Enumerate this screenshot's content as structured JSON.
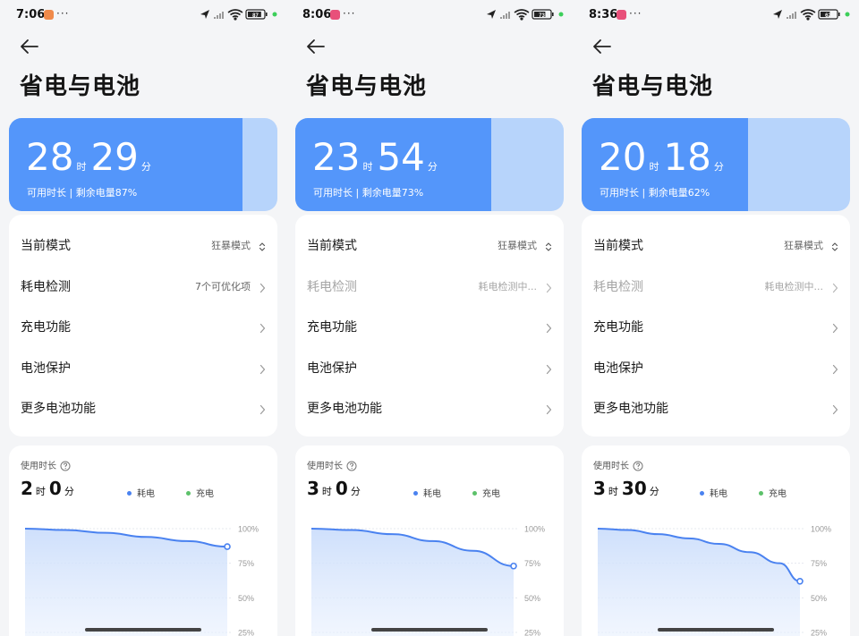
{
  "panels": [
    {
      "status": {
        "time": "7:06",
        "app_color": "#f08a4b",
        "more": "···",
        "battery_text": "87"
      },
      "title": "省电与电池",
      "battery": {
        "hours": "28",
        "hour_unit": "时",
        "minutes": "29",
        "minute_unit": "分",
        "subtitle": "可用时长 | 剩余电量87%",
        "level": 0.87
      },
      "menu": [
        {
          "label": "当前模式",
          "value": "狂暴模式",
          "icon": "updown-icon",
          "dim": false
        },
        {
          "label": "耗电检测",
          "value": "7个可优化项",
          "icon": "chevron-right-icon",
          "dim": false
        },
        {
          "label": "充电功能",
          "value": "",
          "icon": "chevron-right-icon",
          "dim": false
        },
        {
          "label": "电池保护",
          "value": "",
          "icon": "chevron-right-icon",
          "dim": false
        },
        {
          "label": "更多电池功能",
          "value": "",
          "icon": "chevron-right-icon",
          "dim": false
        }
      ],
      "usage": {
        "label": "使用时长",
        "hours": "2",
        "hour_unit": "时",
        "minutes": "0",
        "minute_unit": "分",
        "legend": [
          {
            "label": "耗电",
            "color": "#4a82f0"
          },
          {
            "label": "充电",
            "color": "#5cc16a"
          }
        ]
      },
      "chart_data": {
        "type": "area",
        "x": [
          0,
          0.2,
          0.4,
          0.6,
          0.8,
          1.0
        ],
        "series": [
          {
            "values": [
              100,
              99,
              97,
              94,
              91,
              87
            ]
          }
        ],
        "y_ticks": [
          "100%",
          "75%",
          "50%",
          "25%"
        ],
        "ylim": [
          25,
          100
        ]
      }
    },
    {
      "status": {
        "time": "8:06",
        "app_color": "#e8507a",
        "more": "···",
        "battery_text": "73"
      },
      "title": "省电与电池",
      "battery": {
        "hours": "23",
        "hour_unit": "时",
        "minutes": "54",
        "minute_unit": "分",
        "subtitle": "可用时长 | 剩余电量73%",
        "level": 0.73
      },
      "menu": [
        {
          "label": "当前模式",
          "value": "狂暴模式",
          "icon": "updown-icon",
          "dim": false
        },
        {
          "label": "耗电检测",
          "value": "耗电检测中...",
          "icon": "chevron-right-icon",
          "dim": true
        },
        {
          "label": "充电功能",
          "value": "",
          "icon": "chevron-right-icon",
          "dim": false
        },
        {
          "label": "电池保护",
          "value": "",
          "icon": "chevron-right-icon",
          "dim": false
        },
        {
          "label": "更多电池功能",
          "value": "",
          "icon": "chevron-right-icon",
          "dim": false
        }
      ],
      "usage": {
        "label": "使用时长",
        "hours": "3",
        "hour_unit": "时",
        "minutes": "0",
        "minute_unit": "分",
        "legend": [
          {
            "label": "耗电",
            "color": "#4a82f0"
          },
          {
            "label": "充电",
            "color": "#5cc16a"
          }
        ]
      },
      "chart_data": {
        "type": "area",
        "x": [
          0,
          0.2,
          0.4,
          0.6,
          0.8,
          1.0
        ],
        "series": [
          {
            "values": [
              100,
              99,
              96,
              91,
              84,
              73
            ]
          }
        ],
        "y_ticks": [
          "100%",
          "75%",
          "50%",
          "25%"
        ],
        "ylim": [
          25,
          100
        ]
      }
    },
    {
      "status": {
        "time": "8:36",
        "app_color": "#e8507a",
        "more": "···",
        "battery_text": "62"
      },
      "title": "省电与电池",
      "battery": {
        "hours": "20",
        "hour_unit": "时",
        "minutes": "18",
        "minute_unit": "分",
        "subtitle": "可用时长 | 剩余电量62%",
        "level": 0.62
      },
      "menu": [
        {
          "label": "当前模式",
          "value": "狂暴模式",
          "icon": "updown-icon",
          "dim": false
        },
        {
          "label": "耗电检测",
          "value": "耗电检测中...",
          "icon": "chevron-right-icon",
          "dim": true
        },
        {
          "label": "充电功能",
          "value": "",
          "icon": "chevron-right-icon",
          "dim": false
        },
        {
          "label": "电池保护",
          "value": "",
          "icon": "chevron-right-icon",
          "dim": false
        },
        {
          "label": "更多电池功能",
          "value": "",
          "icon": "chevron-right-icon",
          "dim": false
        }
      ],
      "usage": {
        "label": "使用时长",
        "hours": "3",
        "hour_unit": "时",
        "minutes": "30",
        "minute_unit": "分",
        "legend": [
          {
            "label": "耗电",
            "color": "#4a82f0"
          },
          {
            "label": "充电",
            "color": "#5cc16a"
          }
        ]
      },
      "chart_data": {
        "type": "area",
        "x": [
          0,
          0.15,
          0.3,
          0.45,
          0.6,
          0.75,
          0.9,
          1.0
        ],
        "series": [
          {
            "values": [
              100,
              99,
              96,
              93,
              89,
              83,
              75,
              62
            ]
          }
        ],
        "y_ticks": [
          "100%",
          "75%",
          "50%",
          "25%"
        ],
        "ylim": [
          25,
          100
        ]
      }
    }
  ],
  "colors": {
    "accent": "#5496fa",
    "accent_light": "#b7d4fb",
    "line": "#4a82f0"
  }
}
